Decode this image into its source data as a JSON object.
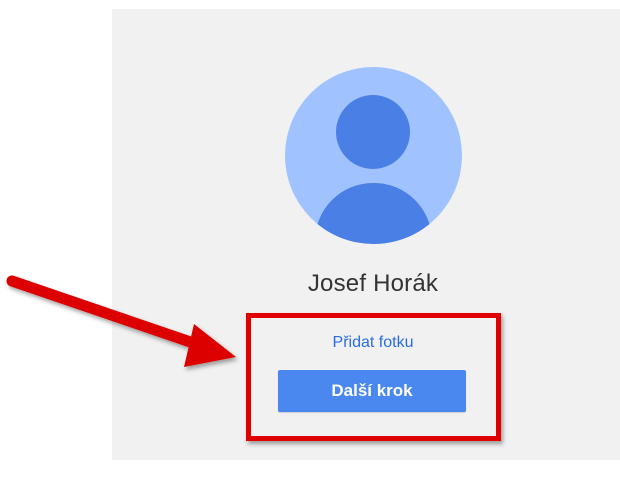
{
  "profile": {
    "name": "Josef Horák",
    "avatar_icon": "default-user-avatar-icon"
  },
  "actions": {
    "add_photo_label": "Přidat fotku",
    "next_label": "Další krok"
  },
  "annotation": {
    "arrow_icon": "red-arrow-icon",
    "highlight_color": "#e00000"
  },
  "colors": {
    "card_background": "#f1f1f1",
    "avatar_light": "#a0c3ff",
    "avatar_dark": "#4a80e6",
    "link": "#2a6de0",
    "button": "#4a87ee"
  }
}
